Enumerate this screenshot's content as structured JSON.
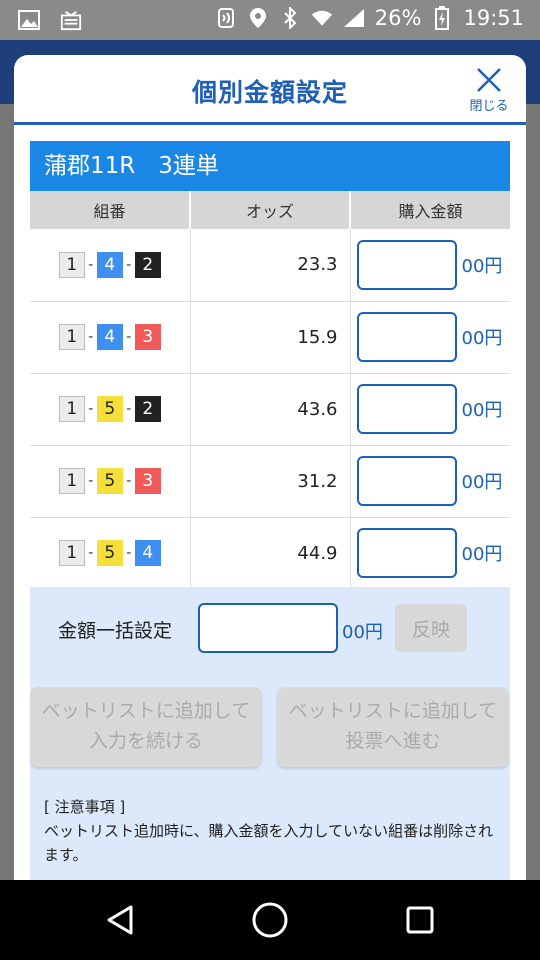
{
  "status_bar": {
    "battery": "26%",
    "time": "19:51"
  },
  "modal": {
    "title": "個別金額設定",
    "close_label": "閉じる"
  },
  "race": {
    "title": "蒲郡11R　3連単"
  },
  "table": {
    "headers": [
      "組番",
      "オッズ",
      "購入金額"
    ],
    "unit": "00円",
    "rows": [
      {
        "combo": [
          "1",
          "4",
          "2"
        ],
        "odds": "23.3",
        "amount": ""
      },
      {
        "combo": [
          "1",
          "4",
          "3"
        ],
        "odds": "15.9",
        "amount": ""
      },
      {
        "combo": [
          "1",
          "5",
          "2"
        ],
        "odds": "43.6",
        "amount": ""
      },
      {
        "combo": [
          "1",
          "5",
          "3"
        ],
        "odds": "31.2",
        "amount": ""
      },
      {
        "combo": [
          "1",
          "5",
          "4"
        ],
        "odds": "44.9",
        "amount": ""
      }
    ]
  },
  "bulk": {
    "label": "金額一括設定",
    "value": "",
    "unit": "00円",
    "reflect_label": "反映"
  },
  "actions": {
    "continue_line1": "ベットリストに追加して",
    "continue_line2": "入力を続ける",
    "proceed_line1": "ベットリストに追加して",
    "proceed_line2": "投票へ進む"
  },
  "notes": {
    "heading": "[ 注意事項 ]",
    "body": "ベットリスト追加時に、購入金額を入力していない組番は削除されます。"
  },
  "colors": {
    "primary": "#1e5fb8",
    "race_header": "#1a87e6",
    "bulk_bg": "#dce9fa"
  }
}
